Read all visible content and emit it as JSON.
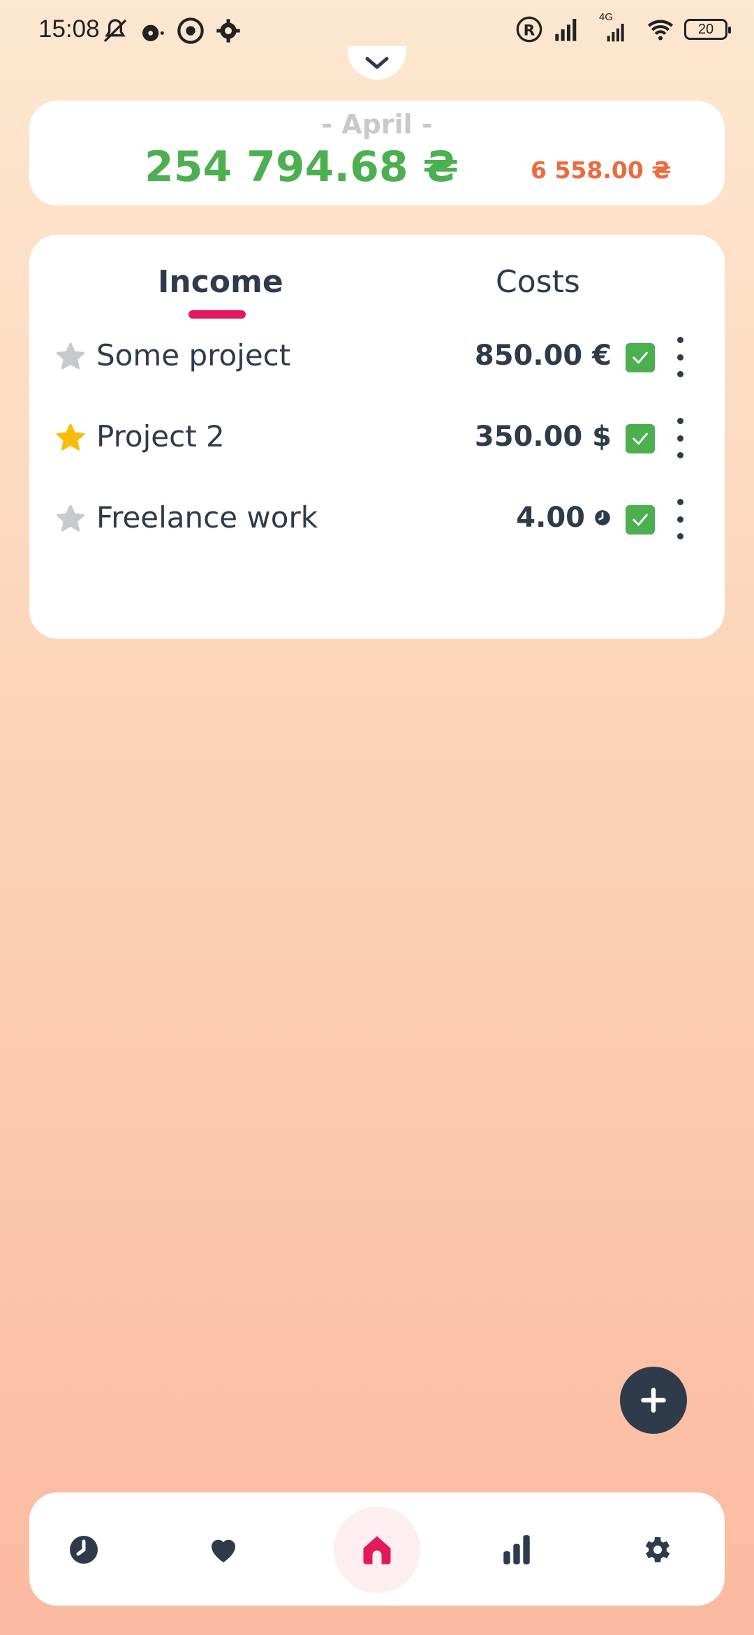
{
  "status_bar": {
    "time": "15:08",
    "network_label": "4G",
    "battery": "20",
    "left_icons": [
      "bell-off-icon",
      "music-icon",
      "chrome-icon",
      "gear-icon"
    ],
    "right_icons": [
      "registered-icon",
      "signal-icon",
      "signal-4g-icon",
      "wifi-icon",
      "battery-icon"
    ]
  },
  "summary": {
    "month": "- April -",
    "income_total": "254 794.68 ₴",
    "cost_total": "6 558.00 ₴"
  },
  "tabs": [
    {
      "label": "Income",
      "active": true
    },
    {
      "label": "Costs",
      "active": false
    }
  ],
  "items": [
    {
      "name": "Some project",
      "amount": "850.00 €",
      "favorite": false,
      "checked": true
    },
    {
      "name": "Project 2",
      "amount": "350.00 $",
      "favorite": true,
      "checked": true
    },
    {
      "name": "Freelance work",
      "amount": "4.00",
      "amount_unit_icon": "clock-icon",
      "favorite": false,
      "checked": true
    }
  ],
  "nav": [
    {
      "icon": "clock-icon",
      "active": false
    },
    {
      "icon": "heart-icon",
      "active": false
    },
    {
      "icon": "home-icon",
      "active": true
    },
    {
      "icon": "bar-chart-icon",
      "active": false
    },
    {
      "icon": "gear-icon",
      "active": false
    }
  ],
  "colors": {
    "income": "#4caf50",
    "cost": "#ee6a3c",
    "accent": "#e3195b",
    "dark": "#2f3a4a",
    "favorite_star": "#f7bd0a",
    "inactive_star": "#c8c9cd"
  }
}
